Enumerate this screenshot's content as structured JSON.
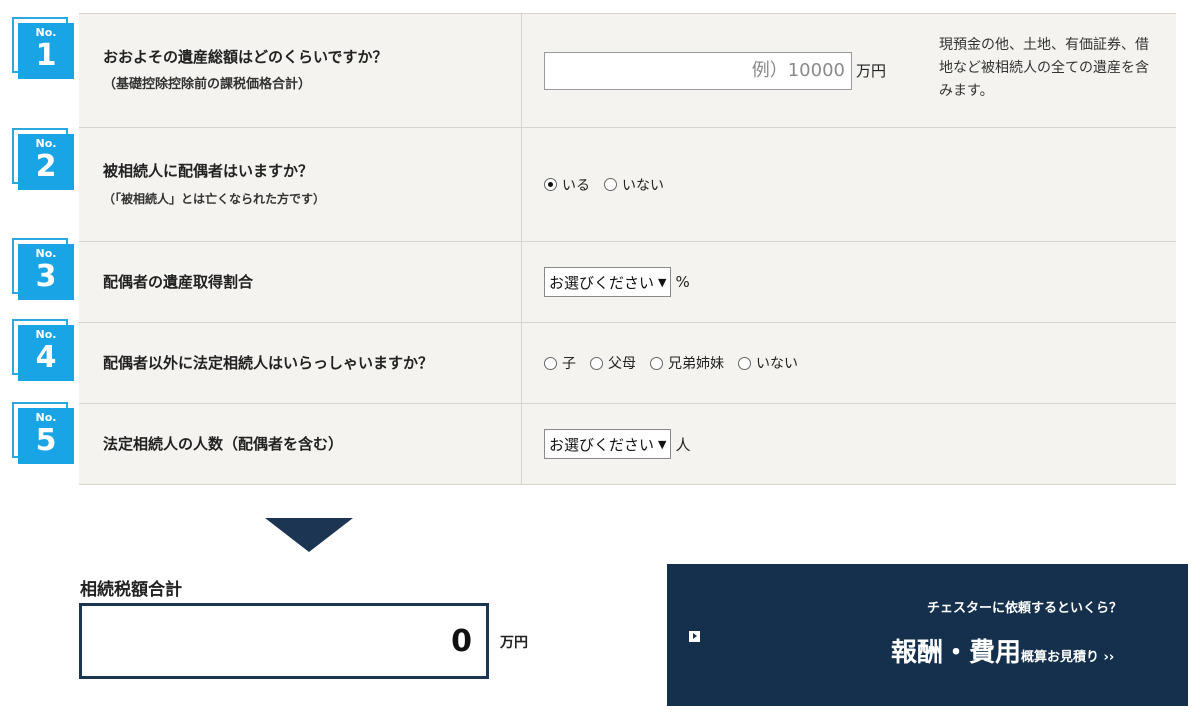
{
  "questions": [
    {
      "badge_no": "No.",
      "number": "1",
      "title": "おおよその遺産総額はどのくらいですか？",
      "sub": "（基礎控除控除前の課税価格合計）",
      "input_placeholder": "例）10000",
      "unit": "万円",
      "note": "現預金の他、土地、有価証券、借地など被相続人の全ての遺産を含みます。"
    },
    {
      "badge_no": "No.",
      "number": "2",
      "title": "被相続人に配偶者はいますか？",
      "sub": "（「被相続人」とは亡くなられた方です）",
      "options": [
        "いる",
        "いない"
      ],
      "selected": "いる"
    },
    {
      "badge_no": "No.",
      "number": "3",
      "title": "配偶者の遺産取得割合",
      "select_value": "お選びください",
      "unit": "%"
    },
    {
      "badge_no": "No.",
      "number": "4",
      "title": "配偶者以外に法定相続人はいらっしゃいますか？",
      "options": [
        "子",
        "父母",
        "兄弟姉妹",
        "いない"
      ]
    },
    {
      "badge_no": "No.",
      "number": "5",
      "title": "法定相続人の人数（配偶者を含む）",
      "select_value": "お選びください",
      "unit": "人"
    }
  ],
  "result": {
    "label": "相続税額合計",
    "value": "0",
    "unit": "万円"
  },
  "cta": {
    "sub": "チェスターに依頼するといくら？",
    "main": "報酬・費用",
    "small": "概算お見積り ››",
    "color": "#15304d"
  },
  "colors": {
    "badge": "#19a4e6",
    "row_bg": "#f4f3ef",
    "navy": "#1c3552"
  }
}
